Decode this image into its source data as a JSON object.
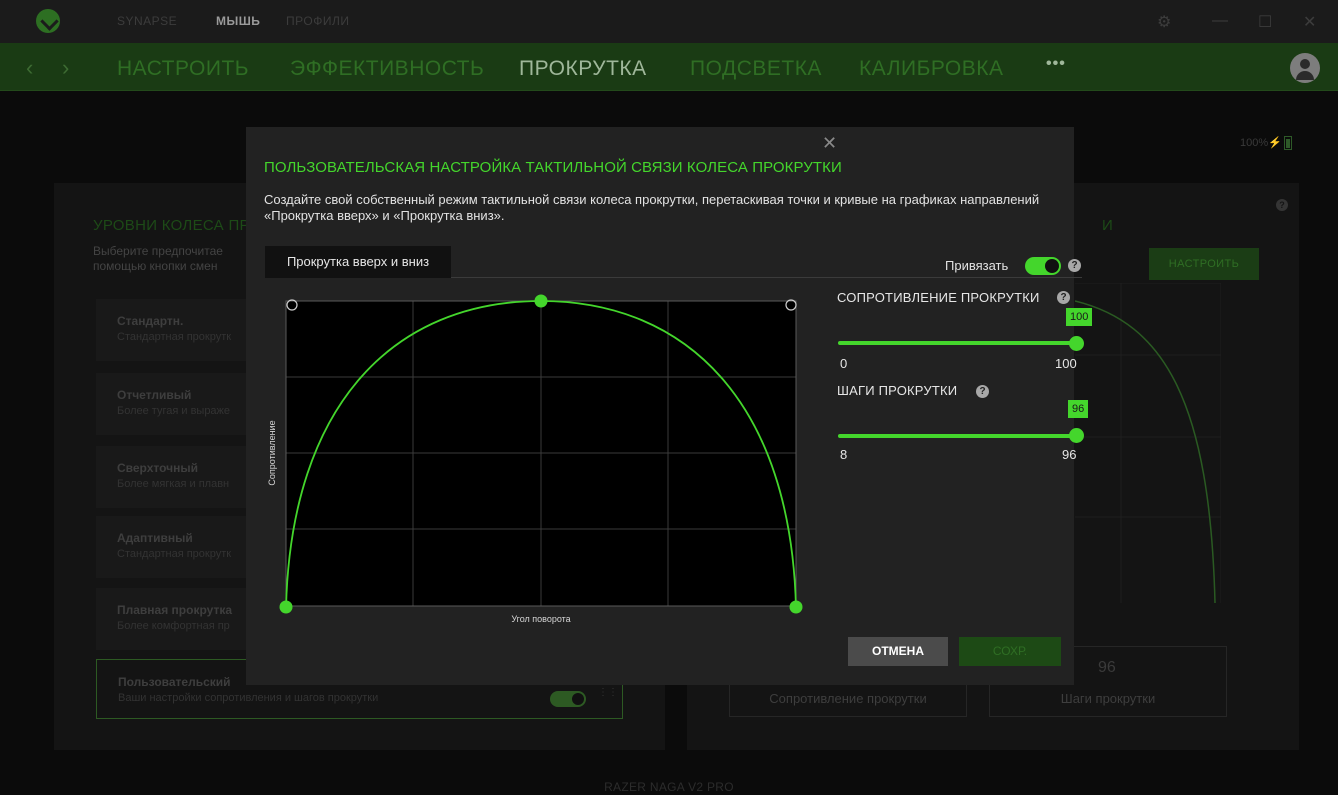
{
  "topbar": {
    "tabs": [
      "SYNAPSE",
      "МЫШЬ",
      "ПРОФИЛИ"
    ],
    "active_tab": "МЫШЬ"
  },
  "nav": {
    "tabs": [
      "НАСТРОИТЬ",
      "ЭФФЕКТИВНОСТЬ",
      "ПРОКРУТКА",
      "ПОДСВЕТКА",
      "КАЛИБРОВКА"
    ],
    "active_tab": "ПРОКРУТКА",
    "more": "•••"
  },
  "battery": {
    "text": "100%"
  },
  "left_panel": {
    "title": "УРОВНИ КОЛЕСА ПР",
    "desc": "Выберите предпочитае\nпомощью кнопки смен",
    "presets": [
      {
        "name": "Стандартн.",
        "desc": "Стандартная прокрутк"
      },
      {
        "name": "Отчетливый",
        "desc": "Более тугая и выраже"
      },
      {
        "name": "Сверхточный",
        "desc": "Более мягкая и плавн"
      },
      {
        "name": "Адаптивный",
        "desc": "Стандартная прокрутк"
      },
      {
        "name": "Плавная прокрутка",
        "desc": "Более комфортная пр"
      }
    ],
    "custom": {
      "name": "Пользовательский",
      "desc": "Ваши настройки сопротивления и шагов прокрутки"
    }
  },
  "right_panel": {
    "title_fragment": "И",
    "button": "НАСТРОИТЬ",
    "stats": [
      {
        "value": "",
        "label": "Сопротивление прокрутки"
      },
      {
        "value": "96",
        "label": "Шаги прокрутки"
      }
    ]
  },
  "footer": {
    "device": "RAZER NAGA V2 PRO"
  },
  "modal": {
    "close": "✕",
    "title": "ПОЛЬЗОВАТЕЛЬСКАЯ НАСТРОЙКА ТАКТИЛЬНОЙ СВЯЗИ КОЛЕСА ПРОКРУТКИ",
    "desc": "Создайте свой собственный режим тактильной связи колеса прокрутки, перетаскивая точки и кривые на графиках направлений «Прокрутка вверх» и «Прокрутка вниз».",
    "tab": "Прокрутка вверх и вниз",
    "bind": {
      "label": "Привязать",
      "on": true
    },
    "chart": {
      "xlabel": "Угол поворота",
      "ylabel": "Сопротивление"
    },
    "resistance": {
      "title": "СОПРОТИВЛЕНИЕ ПРОКРУТКИ",
      "value": "100",
      "min": "0",
      "max": "100",
      "fraction": 1.0
    },
    "steps": {
      "title": "ШАГИ ПРОКРУТКИ",
      "value": "96",
      "min": "8",
      "max": "96",
      "fraction": 1.0
    },
    "cancel": "ОТМЕНА",
    "save": "СОХР."
  },
  "colors": {
    "accent": "#44d62c",
    "modal_bg": "#222222",
    "chart_bg": "#000000"
  }
}
